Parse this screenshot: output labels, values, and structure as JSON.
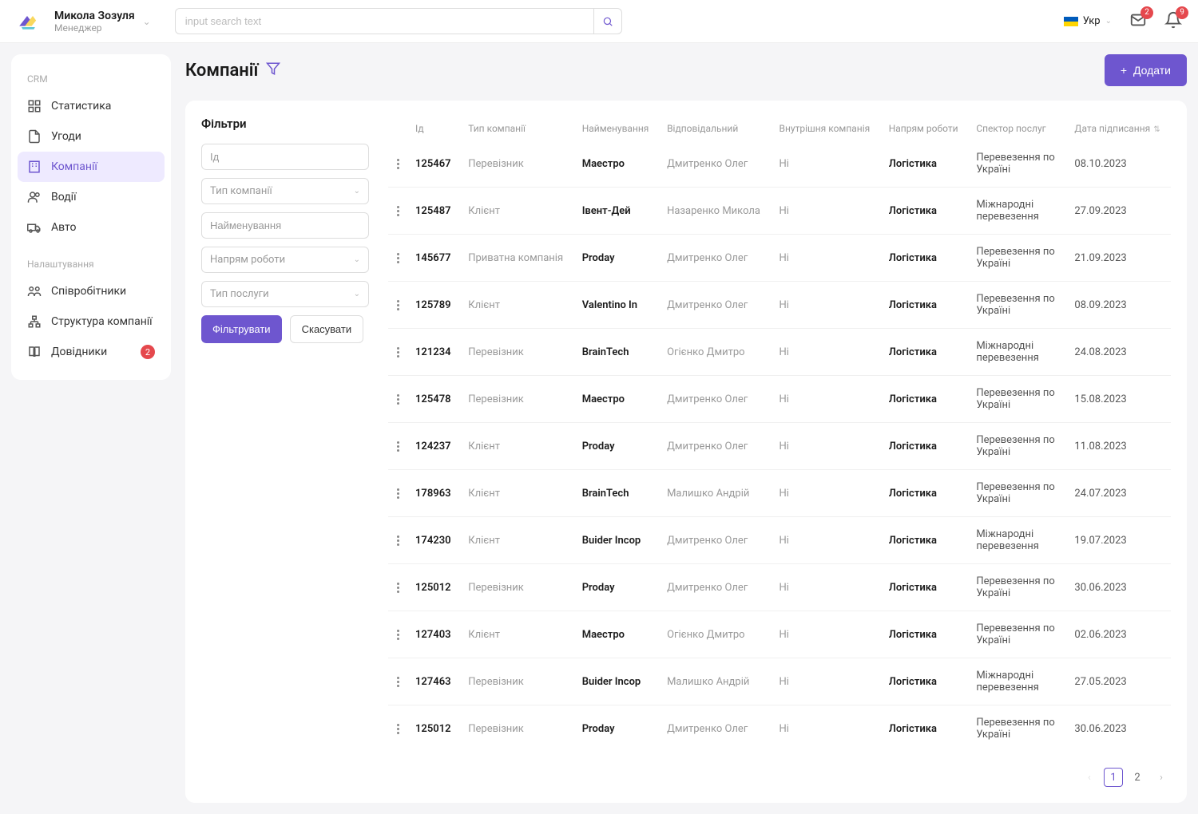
{
  "header": {
    "user_name": "Микола Зозуля",
    "user_role": "Менеджер",
    "search_placeholder": "input search text",
    "lang": "Укр",
    "mail_badge": "2",
    "bell_badge": "9"
  },
  "sidebar": {
    "section_crm": "CRM",
    "section_settings": "Налаштування",
    "items_crm": [
      {
        "label": "Статистика"
      },
      {
        "label": "Угоди"
      },
      {
        "label": "Компанії"
      },
      {
        "label": "Водії"
      },
      {
        "label": "Авто"
      }
    ],
    "items_settings": [
      {
        "label": "Співробітники"
      },
      {
        "label": "Структура компанії"
      },
      {
        "label": "Довідники",
        "badge": "2"
      }
    ]
  },
  "page": {
    "title": "Компанії",
    "add_btn": "Додати"
  },
  "filters": {
    "title": "Фільтри",
    "id_placeholder": "Ід",
    "type_placeholder": "Тип компанії",
    "name_placeholder": "Найменування",
    "direction_placeholder": "Напрям роботи",
    "service_placeholder": "Тип послуги",
    "apply": "Фільтрувати",
    "cancel": "Скасувати"
  },
  "table": {
    "columns": [
      "Ід",
      "Тип компанії",
      "Найменування",
      "Відповідальний",
      "Внутрішня компанія",
      "Напрям роботи",
      "Спектор послуг",
      "Дата підписання"
    ],
    "rows": [
      {
        "id": "125467",
        "type": "Перевізник",
        "name": "Маестро",
        "resp": "Дмитренко Олег",
        "internal": "Ні",
        "dir": "Логістика",
        "spec": "Перевезення по Україні",
        "date": "08.10.2023"
      },
      {
        "id": "125487",
        "type": "Клієнт",
        "name": "Івент-Дей",
        "resp": "Назаренко Микола",
        "internal": "Ні",
        "dir": "Логістика",
        "spec": "Міжнародні перевезення",
        "date": "27.09.2023"
      },
      {
        "id": "145677",
        "type": "Приватна компанія",
        "name": "Proday",
        "resp": "Дмитренко Олег",
        "internal": "Ні",
        "dir": "Логістика",
        "spec": "Перевезення по Україні",
        "date": "21.09.2023"
      },
      {
        "id": "125789",
        "type": "Клієнт",
        "name": "Valentino In",
        "resp": "Дмитренко Олег",
        "internal": "Ні",
        "dir": "Логістика",
        "spec": "Перевезення по Україні",
        "date": "08.09.2023"
      },
      {
        "id": "121234",
        "type": "Перевізник",
        "name": "BrainTech",
        "resp": "Огієнко Дмитро",
        "internal": "Ні",
        "dir": "Логістика",
        "spec": "Міжнародні перевезення",
        "date": "24.08.2023"
      },
      {
        "id": "125478",
        "type": "Перевізник",
        "name": "Маестро",
        "resp": "Дмитренко Олег",
        "internal": "Ні",
        "dir": "Логістика",
        "spec": "Перевезення по Україні",
        "date": "15.08.2023"
      },
      {
        "id": "124237",
        "type": "Клієнт",
        "name": "Proday",
        "resp": "Дмитренко Олег",
        "internal": "Ні",
        "dir": "Логістика",
        "spec": "Перевезення по Україні",
        "date": "11.08.2023"
      },
      {
        "id": "178963",
        "type": "Клієнт",
        "name": "BrainTech",
        "resp": "Малишко Андрій",
        "internal": "Ні",
        "dir": "Логістика",
        "spec": "Перевезення по Україні",
        "date": "24.07.2023"
      },
      {
        "id": "174230",
        "type": "Клієнт",
        "name": "Buider Incop",
        "resp": "Дмитренко Олег",
        "internal": "Ні",
        "dir": "Логістика",
        "spec": "Міжнародні перевезення",
        "date": "19.07.2023"
      },
      {
        "id": "125012",
        "type": "Перевізник",
        "name": "Proday",
        "resp": "Дмитренко Олег",
        "internal": "Ні",
        "dir": "Логістика",
        "spec": "Перевезення по Україні",
        "date": "30.06.2023"
      },
      {
        "id": "127403",
        "type": "Клієнт",
        "name": "Маестро",
        "resp": "Огієнко Дмитро",
        "internal": "Ні",
        "dir": "Логістика",
        "spec": "Перевезення по Україні",
        "date": "02.06.2023"
      },
      {
        "id": "127463",
        "type": "Перевізник",
        "name": "Buider Incop",
        "resp": "Малишко Андрій",
        "internal": "Ні",
        "dir": "Логістика",
        "spec": "Міжнародні перевезення",
        "date": "27.05.2023"
      },
      {
        "id": "125012",
        "type": "Перевізник",
        "name": "Proday",
        "resp": "Дмитренко Олег",
        "internal": "Ні",
        "dir": "Логістика",
        "spec": "Перевезення по Україні",
        "date": "30.06.2023"
      }
    ]
  },
  "pagination": {
    "pages": [
      "1",
      "2"
    ],
    "active": "1"
  }
}
